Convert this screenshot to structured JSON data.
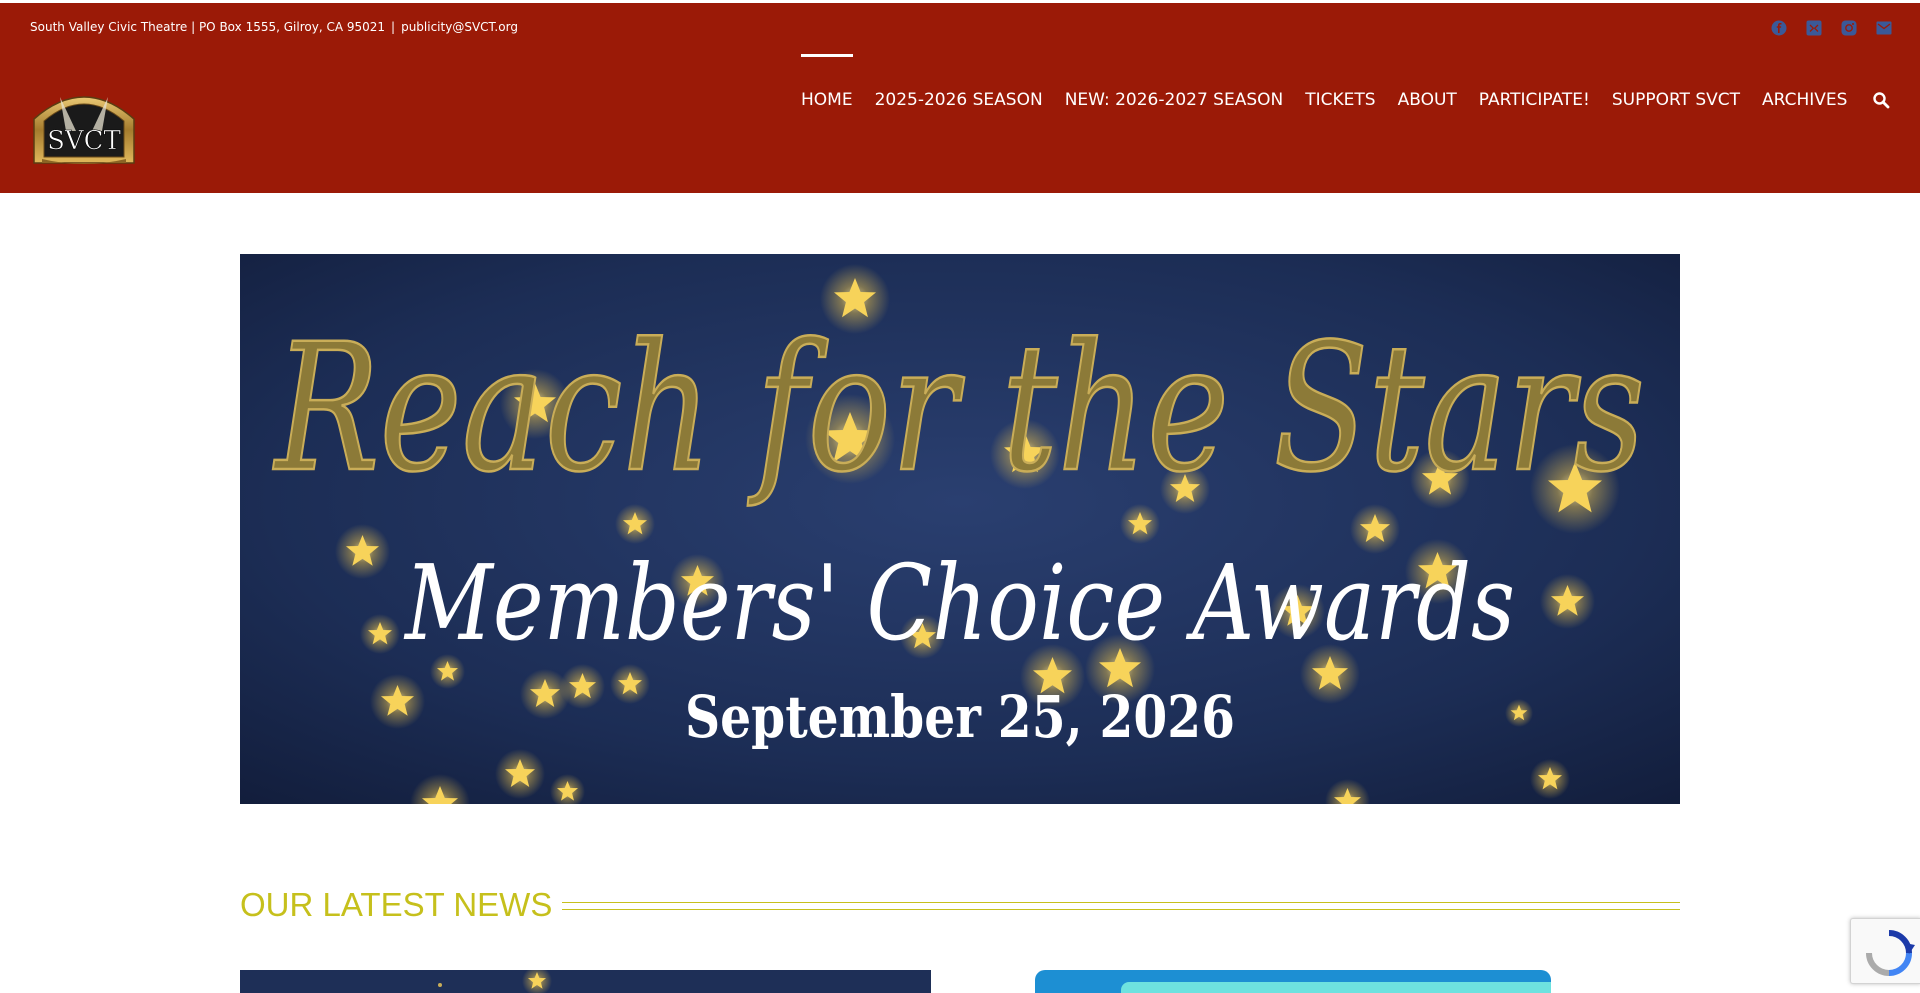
{
  "header": {
    "contact_text": "South Valley Civic Theatre | PO Box 1555, Gilroy, CA 95021",
    "separator": "|",
    "email": "publicity@SVCT.org",
    "logo_text": "SVCT",
    "social_icons": [
      "facebook-icon",
      "twitter-icon",
      "instagram-icon",
      "email-icon"
    ]
  },
  "nav": {
    "items": [
      {
        "label": "HOME",
        "active": true
      },
      {
        "label": "2025-2026 SEASON"
      },
      {
        "label": "NEW: 2026-2027 SEASON"
      },
      {
        "label": "TICKETS"
      },
      {
        "label": "ABOUT"
      },
      {
        "label": "PARTICIPATE!"
      },
      {
        "label": "SUPPORT SVCT"
      },
      {
        "label": "ARCHIVES"
      }
    ],
    "search_icon": "search-icon"
  },
  "banner": {
    "title": "Reach for the Stars",
    "subtitle": "Members' Choice Awards",
    "date": "September 25, 2026"
  },
  "news": {
    "heading": "OUR LATEST NEWS"
  },
  "colors": {
    "header_bg": "#9b1a07",
    "accent": "#c6c01c",
    "banner_bg": "#1c2d55",
    "gold": "#8a7a3a"
  }
}
